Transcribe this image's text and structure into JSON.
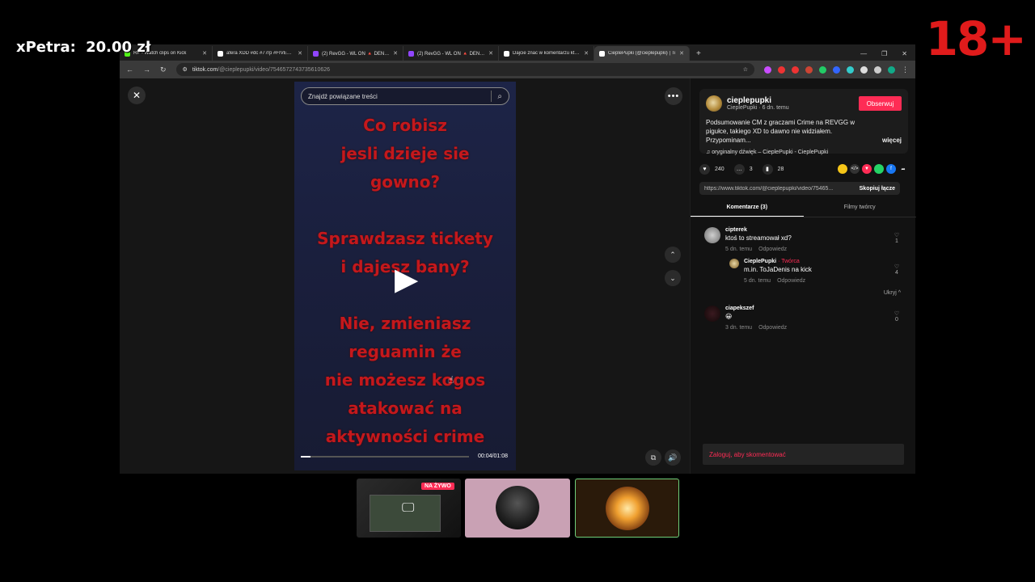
{
  "overlay": {
    "donor": "xPetra:",
    "amount": "20.00 zł",
    "age_badge": "18+"
  },
  "browser": {
    "tabs": [
      {
        "title": "RP - Watch clips on Kick",
        "icon_color": "#53fc18",
        "active": false
      },
      {
        "title": "afera XDD #dc #77rp #FIVEM #",
        "icon_color": "#ffffff",
        "active": false
      },
      {
        "title": "(2) RevGG - WL ON 🔺 DENIS 🔺",
        "icon_color": "#9146ff",
        "active": false
      },
      {
        "title": "(2) RevGG - WL ON 🔺 DENIS 🔺",
        "icon_color": "#9146ff",
        "active": false
      },
      {
        "title": "Dajcie znac w komentarzu kto c",
        "icon_color": "#ffffff",
        "active": false
      },
      {
        "title": "CieplePupki (@cieplepupki) | Ti",
        "icon_color": "#ffffff",
        "active": true
      }
    ],
    "new_tab": "+",
    "url_host": "tiktok.com",
    "url_path": "/@cieplepupki/video/7546572743735610626"
  },
  "video": {
    "search_placeholder": "Znajdź powiązane treści",
    "lines_block1": [
      "Co robisz",
      "jesli dzieje sie",
      "gowno?"
    ],
    "lines_block2": [
      "Sprawdzasz tickety",
      "i dajesz bany?"
    ],
    "lines_block3": [
      "Nie, zmieniasz",
      "reguamin że",
      "nie możesz kogos",
      "atakować na",
      "aktywności crime"
    ],
    "timecode": "00:04/01:08",
    "progress": 0.06
  },
  "post": {
    "author": "cieplepupki",
    "author_sub": "CieplePupki · 6 dn. temu",
    "follow_label": "Obserwuj",
    "description": "Podsumowanie CM z graczami Crime na REVGG w pigułce, takiego XD to dawno nie widziałem. Przypominam...",
    "more_label": "więcej",
    "sound": "oryginalny dźwięk – CieplePupki - CieplePupki",
    "likes": "240",
    "comments_count": "3",
    "saves": "28",
    "link": "https://www.tiktok.com/@cieplepupki/video/75465...",
    "copy_label": "Skopiuj łącze",
    "tab_comments": "Komentarze (3)",
    "tab_videos": "Filmy twórcy"
  },
  "comments": [
    {
      "user": "cipterek",
      "text": "ktoś to streamował xd?",
      "time": "5 dn. temu",
      "reply": "Odpowiedz",
      "likes": "1"
    },
    {
      "user": "CieplePupki",
      "tag": "· Twórca",
      "text": "m.in. ToJaDenis na kick",
      "time": "5 dn. temu",
      "reply": "Odpowiedz",
      "likes": "4"
    },
    {
      "user": "ciapekszef",
      "text": "😀",
      "time": "3 dn. temu",
      "reply": "Odpowiedz",
      "likes": "0"
    }
  ],
  "hide_label": "Ukryj ^",
  "login_prompt": "Zaloguj, aby skomentować",
  "live_badge": "NA ŻYWO"
}
